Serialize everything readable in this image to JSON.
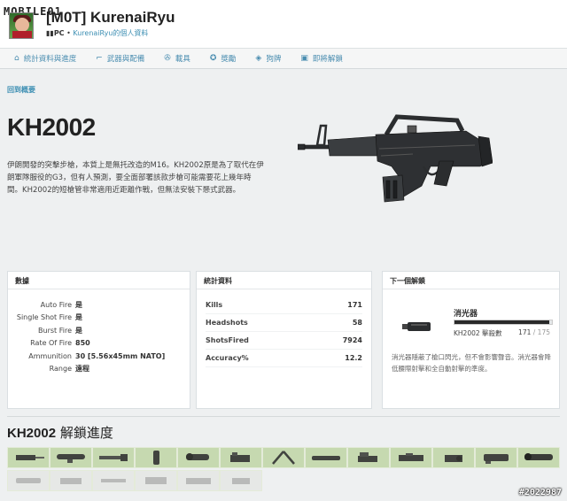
{
  "site": {
    "logo": "MOBILE01",
    "watermark": "#2022987"
  },
  "profile": {
    "username": "[M0T] KurenaiRyu",
    "platform": "PC",
    "separator": "•",
    "profile_link": "KurenaiRyu的個人資料"
  },
  "nav": {
    "items": [
      {
        "label": "統計資料與進度",
        "icon": "home-icon"
      },
      {
        "label": "武器與配備",
        "icon": "gun-icon"
      },
      {
        "label": "載具",
        "icon": "vehicle-icon"
      },
      {
        "label": "獎勵",
        "icon": "medal-icon"
      },
      {
        "label": "狗牌",
        "icon": "dogtag-icon"
      },
      {
        "label": "即將解鎖",
        "icon": "lock-icon"
      }
    ]
  },
  "weapon": {
    "back_link": "回到概要",
    "name": "KH2002",
    "description": "伊朗開發的突擊步槍，本質上是無托改造的M16。KH2002原是為了取代在伊朗軍隊服役的G3，但有人預測，要全面部署該款步槍可能需要花上幾年時間。KH2002的短槍管非常適用近距離作戰，但無法安裝下懸式武器。"
  },
  "specs": {
    "title": "數據",
    "rows": [
      {
        "k": "Auto Fire",
        "v": "是"
      },
      {
        "k": "Single Shot Fire",
        "v": "是"
      },
      {
        "k": "Burst Fire",
        "v": "是"
      },
      {
        "k": "Rate Of Fire",
        "v": "850"
      },
      {
        "k": "Ammunition",
        "v": "30 [5.56x45mm NATO]"
      },
      {
        "k": "Range",
        "v": "遠程"
      }
    ]
  },
  "stats": {
    "title": "統計資料",
    "rows": [
      {
        "k": "Kills",
        "v": "171"
      },
      {
        "k": "Headshots",
        "v": "58"
      },
      {
        "k": "ShotsFired",
        "v": "7924"
      },
      {
        "k": "Accuracy%",
        "v": "12.2"
      }
    ]
  },
  "next_unlock": {
    "title": "下一個解鎖",
    "name": "消光器",
    "label": "KH2002 擊殺數",
    "current": "171",
    "slash": " / ",
    "max": "175",
    "progress": 0.977,
    "description": "消光器隱蔽了槍口閃光，但不會影響聲音。消光器會降低腰際射擊和全自動射擊的準度。"
  },
  "unlocks": {
    "title_bold": "KH2002",
    "title_rest": " 解鎖進度",
    "tiles": [
      {
        "icon": "laser-sight-icon",
        "locked": false
      },
      {
        "icon": "rifle-scope-icon",
        "locked": false
      },
      {
        "icon": "flash-suppressor-icon",
        "locked": false
      },
      {
        "icon": "foregrip-icon",
        "locked": false
      },
      {
        "icon": "acog-scope-icon",
        "locked": false
      },
      {
        "icon": "reflex-sight-icon",
        "locked": false
      },
      {
        "icon": "bipod-icon",
        "locked": false
      },
      {
        "icon": "heavy-barrel-icon",
        "locked": false
      },
      {
        "icon": "holo-sight-icon",
        "locked": false
      },
      {
        "icon": "pka-scope-icon",
        "locked": false
      },
      {
        "icon": "kobra-sight-icon",
        "locked": false
      },
      {
        "icon": "ir-scope-icon",
        "locked": false
      },
      {
        "icon": "sniper-scope-icon",
        "locked": false
      },
      {
        "icon": "suppressor-icon",
        "locked": true
      },
      {
        "icon": "tactical-light-icon",
        "locked": true
      },
      {
        "icon": "compensator-icon",
        "locked": true
      },
      {
        "icon": "m145-scope-icon",
        "locked": true
      },
      {
        "icon": "extended-mag-icon",
        "locked": true
      },
      {
        "icon": "rangefinder-icon",
        "locked": true
      }
    ]
  }
}
